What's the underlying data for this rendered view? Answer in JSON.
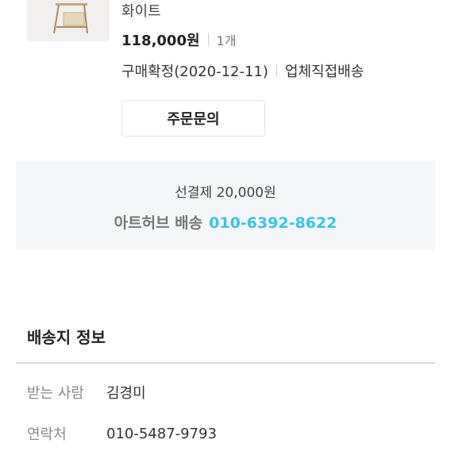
{
  "order_item": {
    "option": "화이트",
    "price": "118,000원",
    "quantity": "1개",
    "status": "구매확정(2020-12-11)",
    "delivery_type": "업체직접배송",
    "inquiry_button": "주문문의"
  },
  "shipping": {
    "fee": "선결제 20,000원",
    "vendor_delivery": "아트허브 배송",
    "vendor_phone": "010-6392-8622"
  },
  "delivery_info": {
    "title": "배송지 정보",
    "rows": [
      {
        "label": "받는 사람",
        "value": "김경미"
      },
      {
        "label": "연락처",
        "value": "010-5487-9793"
      }
    ]
  },
  "colors": {
    "accent": "#35c5f0",
    "panel_bg": "#f5f7f8"
  }
}
